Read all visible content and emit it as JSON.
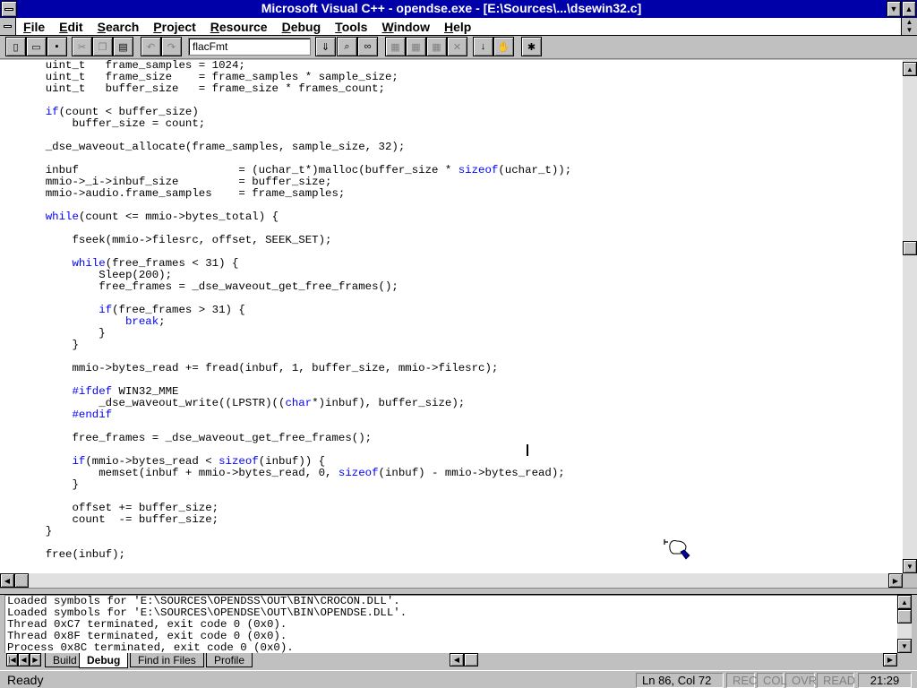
{
  "window": {
    "title": "Microsoft Visual C++ - opendse.exe - [E:\\Sources\\...\\dsewin32.c]"
  },
  "menu": [
    "File",
    "Edit",
    "Search",
    "Project",
    "Resource",
    "Debug",
    "Tools",
    "Window",
    "Help"
  ],
  "toolbar": {
    "combo_value": "flacFmt",
    "buttons": [
      "new-icon",
      "open-icon",
      "save-icon",
      "cut-icon",
      "copy-icon",
      "paste-icon",
      "undo-icon",
      "redo-icon",
      "find-dropdown-icon",
      "find-in-files-icon",
      "binoculars-icon",
      "compile-icon",
      "build-icon",
      "rebuild-icon",
      "stop-build-icon",
      "step-into-icon",
      "go-icon",
      "breakpoint-icon"
    ]
  },
  "code_lines": [
    "    uint_t   frame_samples = 1024;",
    "    uint_t   frame_size    = frame_samples * sample_size;",
    "    uint_t   buffer_size   = frame_size * frames_count;",
    "",
    "    if(count < buffer_size)",
    "        buffer_size = count;",
    "",
    "    _dse_waveout_allocate(frame_samples, sample_size, 32);",
    "",
    "    inbuf                        = (uchar_t*)malloc(buffer_size * sizeof(uchar_t));",
    "    mmio->_i->inbuf_size         = buffer_size;",
    "    mmio->audio.frame_samples    = frame_samples;",
    "",
    "    while(count <= mmio->bytes_total) {",
    "",
    "        fseek(mmio->filesrc, offset, SEEK_SET);",
    "",
    "        while(free_frames < 31) {",
    "            Sleep(200);",
    "            free_frames = _dse_waveout_get_free_frames();",
    "",
    "            if(free_frames > 31) {",
    "                break;",
    "            }",
    "        }",
    "",
    "        mmio->bytes_read += fread(inbuf, 1, buffer_size, mmio->filesrc);",
    "",
    "        #ifdef WIN32_MME",
    "            _dse_waveout_write((LPSTR)((char*)inbuf), buffer_size);",
    "        #endif",
    "",
    "        free_frames = _dse_waveout_get_free_frames();",
    "",
    "        if(mmio->bytes_read < sizeof(inbuf)) {",
    "            memset(inbuf + mmio->bytes_read, 0, sizeof(inbuf) - mmio->bytes_read);",
    "        }",
    "",
    "        offset += buffer_size;",
    "        count  -= buffer_size;",
    "    }",
    "",
    "    free(inbuf);"
  ],
  "keywords": [
    "if",
    "while",
    "sizeof",
    "break",
    "char",
    "#ifdef",
    "#endif"
  ],
  "output_lines": [
    "Loaded symbols for 'E:\\SOURCES\\OPENDSS\\OUT\\BIN\\CROCON.DLL'.",
    "Loaded symbols for 'E:\\SOURCES\\OPENDSE\\OUT\\BIN\\OPENDSE.DLL'.",
    "Thread 0xC7 terminated, exit code 0 (0x0).",
    "Thread 0x8F terminated, exit code 0 (0x0).",
    "Process 0x8C terminated, exit code 0 (0x0)."
  ],
  "output_tabs": [
    "Build",
    "Debug",
    "Find in Files",
    "Profile"
  ],
  "output_active_tab": "Debug",
  "status": {
    "ready": "Ready",
    "position": "Ln 86, Col 72",
    "rec": "REC",
    "col": "COL",
    "ovr": "OVR",
    "read": "READ",
    "time": "21:29"
  }
}
